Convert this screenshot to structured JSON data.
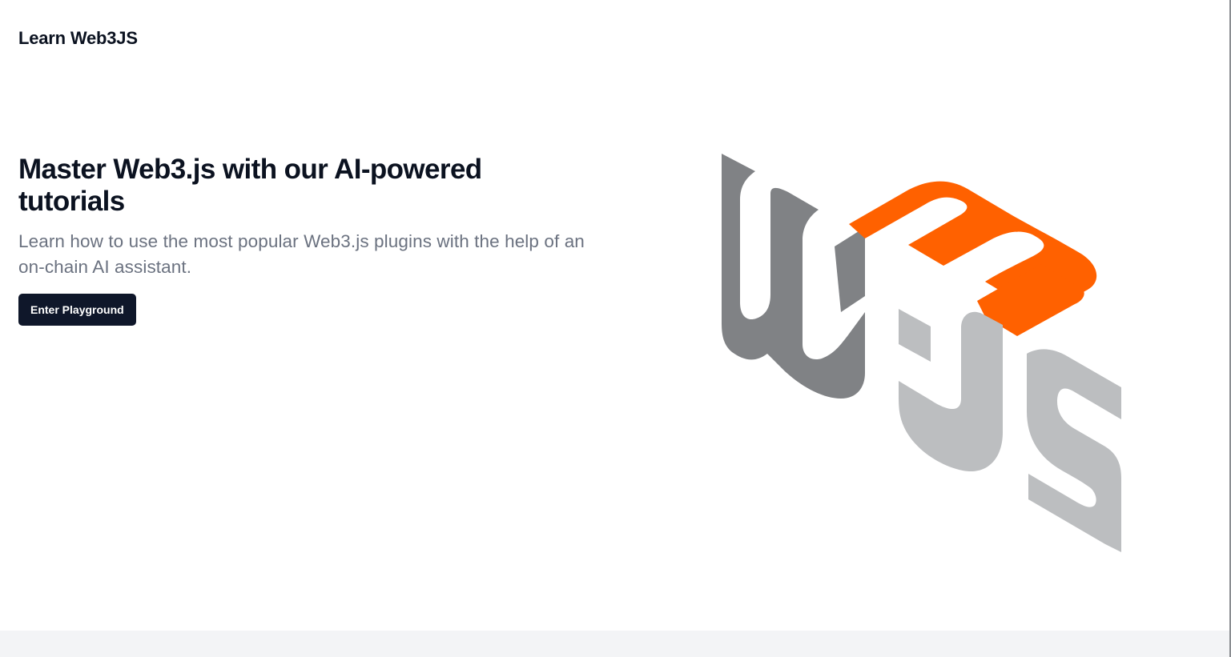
{
  "header": {
    "brand": "Learn Web3JS"
  },
  "hero": {
    "title": "Master Web3.js with our AI-powered tutorials",
    "subtitle": "Learn how to use the most popular Web3.js plugins with the help of an on-chain AI assistant.",
    "cta_label": "Enter Playground"
  },
  "logo": {
    "icon": "web3js-logo",
    "colors": {
      "dark_gray": "#808285",
      "orange": "#FF6100",
      "light_gray": "#BCBEC0"
    }
  },
  "theme": {
    "text_dark": "#0b1220",
    "text_muted": "#6b7280",
    "button_bg": "#0f172a",
    "footer_bg": "#f3f4f6"
  }
}
